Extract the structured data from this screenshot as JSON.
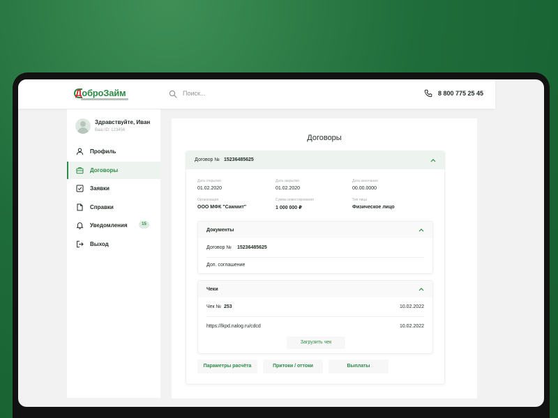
{
  "brand": {
    "logo_letter": "Д",
    "logo_rest": "оброЗайм",
    "accent": "#2d8a46",
    "logo_red": "#d62929"
  },
  "header": {
    "search_placeholder": "Поиск...",
    "phone": "8 800 775 25 45"
  },
  "user": {
    "greeting": "Здравствуйте, Иван",
    "id_text": "Ваш ID: 123456"
  },
  "sidebar": {
    "items": [
      {
        "label": "Профиль",
        "icon": "user-icon"
      },
      {
        "label": "Договоры",
        "icon": "briefcase-icon",
        "active": true
      },
      {
        "label": "Заявки",
        "icon": "checkbox-icon"
      },
      {
        "label": "Справки",
        "icon": "document-icon"
      },
      {
        "label": "Уведомления",
        "icon": "bell-icon",
        "badge": "15"
      },
      {
        "label": "Выход",
        "icon": "logout-icon"
      }
    ]
  },
  "main": {
    "title": "Договоры",
    "contract": {
      "label": "Договор №",
      "number": "15236485625",
      "fields": [
        {
          "label": "Дата открытия",
          "value": "01.02.2020"
        },
        {
          "label": "Дата закрытия",
          "value": "01.02.2020"
        },
        {
          "label": "Дата окончания",
          "value": "00.00.0000"
        },
        {
          "label": "Организация",
          "value": "ООО МФК \"Саммит\""
        },
        {
          "label": "Сумма инвестирования",
          "value": "1 000 000 ₽"
        },
        {
          "label": "Тип лица",
          "value": "Физическое лицо"
        }
      ]
    },
    "documents": {
      "title": "Документы",
      "rows": [
        {
          "label": "Договор №",
          "number": "15236485625"
        },
        {
          "label": "Доп. соглашение"
        }
      ]
    },
    "receipts": {
      "title": "Чеки",
      "rows": [
        {
          "label": "Чек №",
          "number": "253",
          "date": "10.02.2022"
        },
        {
          "label": "https://lkpd.nalog.ru/cdcd",
          "date": "10.02.2022"
        }
      ],
      "upload_label": "Загрузить чек"
    },
    "buttons": {
      "params": "Параметры расчёта",
      "flows": "Притоки / оттоки",
      "payouts": "Выплаты"
    }
  }
}
